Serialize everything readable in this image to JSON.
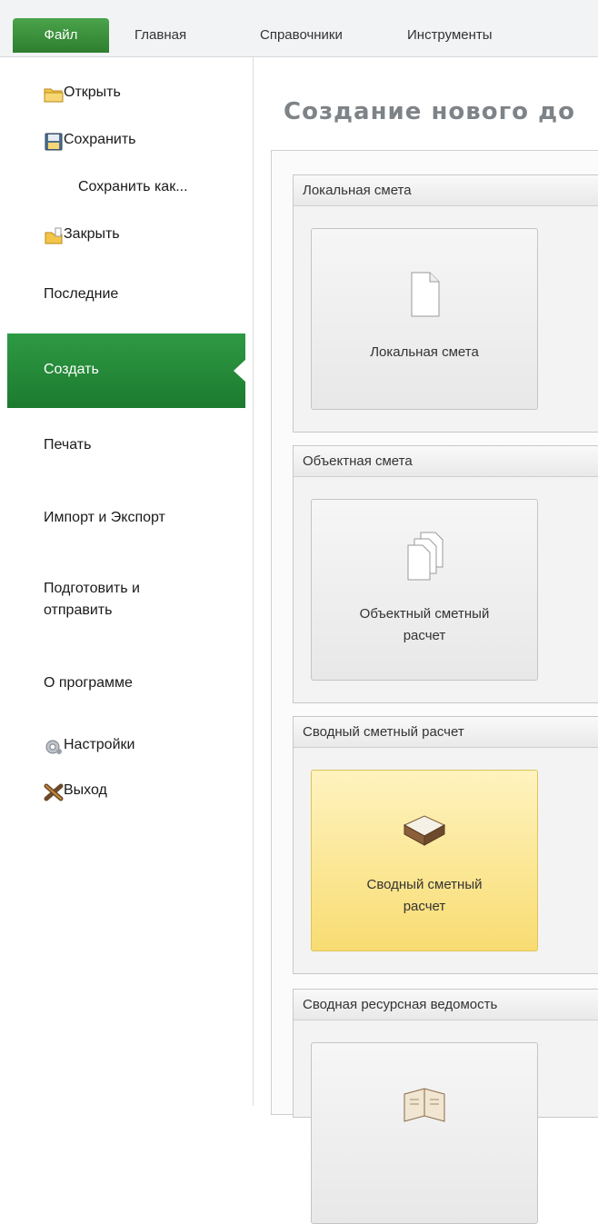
{
  "tabs": [
    "Файл",
    "Главная",
    "Справочники",
    "Инструменты"
  ],
  "menu": {
    "open": "Открыть",
    "save": "Сохранить",
    "save_as": "Сохранить как...",
    "close": "Закрыть",
    "recent": "Последние",
    "create": "Создать",
    "print": "Печать",
    "import_export": "Импорт и Экспорт",
    "prepare_line1": "Подготовить и",
    "prepare_line2": "отправить",
    "about": "О программе",
    "settings": "Настройки",
    "exit": "Выход"
  },
  "main": {
    "title": "Создание нового до",
    "groups": [
      {
        "header": "Локальная смета",
        "card_line1": "Локальная смета",
        "card_line2": ""
      },
      {
        "header": "Объектная смета",
        "card_line1": "Объектный сметный",
        "card_line2": "расчет"
      },
      {
        "header": "Сводный сметный расчет",
        "card_line1": "Сводный сметный",
        "card_line2": "расчет"
      },
      {
        "header": "Сводная ресурсная ведомость",
        "card_line1": "",
        "card_line2": ""
      }
    ]
  },
  "colors": {
    "accent_green": "#2e8b3c",
    "selected_card": "#f8dc72",
    "title_gray": "#7e8388"
  }
}
